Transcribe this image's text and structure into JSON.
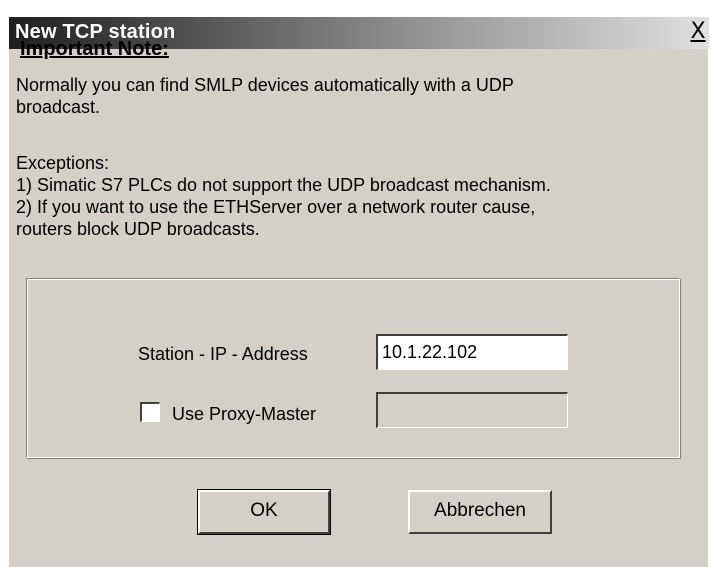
{
  "window": {
    "title": "New TCP station",
    "close_glyph": "X"
  },
  "note": {
    "heading": "Important Note:",
    "paragraph1": "Normally you can find SMLP devices automatically with a UDP\nbroadcast.",
    "paragraph2": "Exceptions:\n1) Simatic S7 PLCs do not support the UDP broadcast mechanism.\n2) If you want to use the ETHServer over a  network router cause,\nrouters block UDP broadcasts."
  },
  "form": {
    "ip_label": "Station - IP - Address",
    "ip_value": "10.1.22.102",
    "proxy_label": "Use Proxy-Master",
    "proxy_checked": false,
    "proxy_value": ""
  },
  "buttons": {
    "ok_label": "OK",
    "cancel_label": "Abbrechen"
  },
  "colors": {
    "dialog_bg": "#d4d0c8",
    "title_gradient_start": "#1f1f1f",
    "title_gradient_end": "#e0e0e0"
  }
}
